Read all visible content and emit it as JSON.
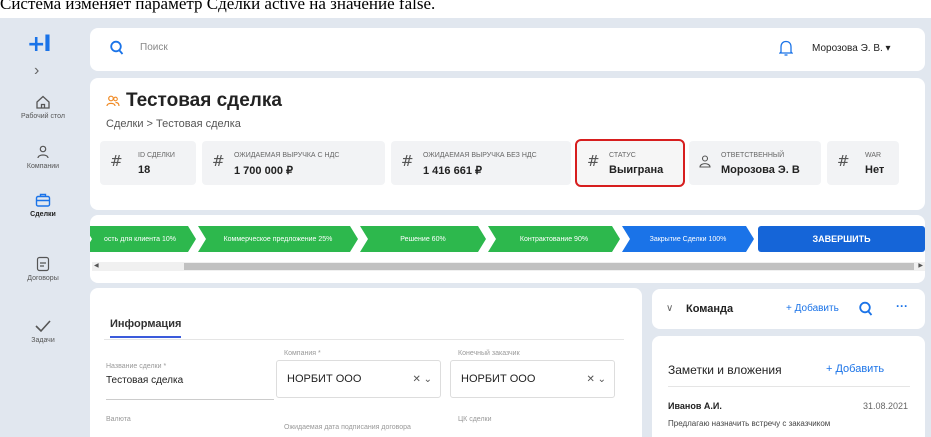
{
  "caption": "Система изменяет параметр Сделки active на значение false.",
  "sidebar": {
    "logo": "+I",
    "expand": "›",
    "items": [
      {
        "label": "Рабочий стол",
        "icon": "home-icon"
      },
      {
        "label": "Компании",
        "icon": "people-icon"
      },
      {
        "label": "Сделки",
        "icon": "briefcase-icon"
      },
      {
        "label": "Договоры",
        "icon": "document-icon"
      },
      {
        "label": "Задачи",
        "icon": "check-icon"
      }
    ]
  },
  "topbar": {
    "search_placeholder": "Поиск",
    "user": "Морозова Э. В.  ▾"
  },
  "header": {
    "title": "Тестовая сделка",
    "breadcrumb": "Сделки  >  Тестовая сделка",
    "stats": [
      {
        "label": "ID СДЕЛКИ",
        "value": "18"
      },
      {
        "label": "ОЖИДАЕМАЯ ВЫРУЧКА С НДС",
        "value": "1 700 000 ₽"
      },
      {
        "label": "ОЖИДАЕМАЯ ВЫРУЧКА БЕЗ НДС",
        "value": "1 416 661 ₽"
      },
      {
        "label": "СТАТУС",
        "value": "Выиграна"
      },
      {
        "label": "ОТВЕТСТВЕННЫЙ",
        "value": "Морозова Э. В"
      },
      {
        "label": "WAR",
        "value": "Нет"
      }
    ]
  },
  "pipeline": {
    "stages": [
      "ость для клиента 10%",
      "Коммерческое предложение 25%",
      "Решение 60%",
      "Контрактование 90%",
      "Закрытие Сделки 100%"
    ],
    "finish_label": "ЗАВЕРШИТЬ"
  },
  "info": {
    "tab": "Информация",
    "fields": {
      "deal_name_label": "Название сделки *",
      "deal_name_value": "Тестовая сделка",
      "company_label": "Компания *",
      "company_value": "НОРБИТ ООО",
      "customer_label": "Конечный заказчик",
      "customer_value": "НОРБИТ ООО",
      "currency_label": "Валюта",
      "sign_date_label": "Ожидаемая дата подписания договора",
      "cc_label": "ЦК сделки"
    }
  },
  "team": {
    "title": "Команда",
    "add": "+ Добавить",
    "more": "···"
  },
  "notes": {
    "title": "Заметки и вложения",
    "add": "+ Добавить",
    "author": "Иванов А.И.",
    "date": "31.08.2021",
    "text": "Предлагаю назначить встречу с заказчиком"
  },
  "colors": {
    "accent": "#1a73e8",
    "stage_green": "#2db84d",
    "highlight": "#d71e1e"
  }
}
